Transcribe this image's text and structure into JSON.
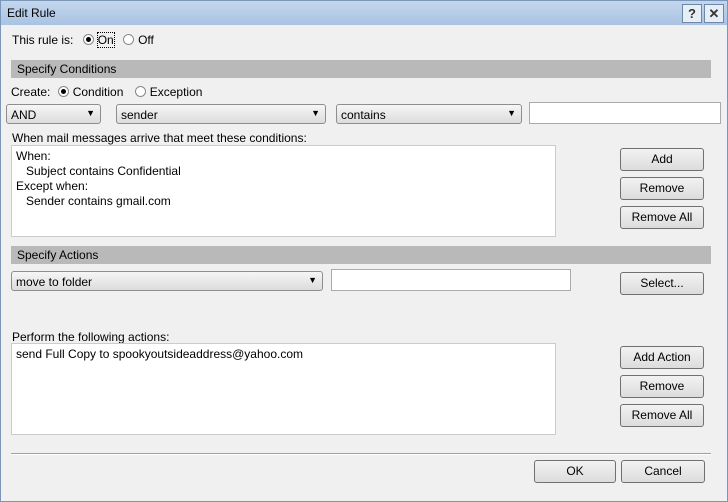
{
  "window": {
    "title": "Edit Rule",
    "help": "?",
    "close": "✕"
  },
  "rule_state": {
    "label": "This rule is:",
    "on": "On",
    "off": "Off",
    "selected": "On"
  },
  "conditions": {
    "header": "Specify Conditions",
    "create_label": "Create:",
    "condition": "Condition",
    "exception": "Exception",
    "selected": "Condition",
    "logic": "AND",
    "field": "sender",
    "operator": "contains",
    "value": "",
    "list_label": "When mail messages arrive that meet these conditions:",
    "lines": [
      "When:",
      "   Subject contains Confidential",
      "Except when:",
      "   Sender contains gmail.com"
    ],
    "add": "Add",
    "remove": "Remove",
    "remove_all": "Remove All"
  },
  "actions": {
    "header": "Specify Actions",
    "action": "move to folder",
    "value": "",
    "select": "Select...",
    "list_label": "Perform the following actions:",
    "lines": [
      "send Full Copy to spookyoutsideaddress@yahoo.com"
    ],
    "add": "Add Action",
    "remove": "Remove",
    "remove_all": "Remove All"
  },
  "footer": {
    "ok": "OK",
    "cancel": "Cancel"
  }
}
